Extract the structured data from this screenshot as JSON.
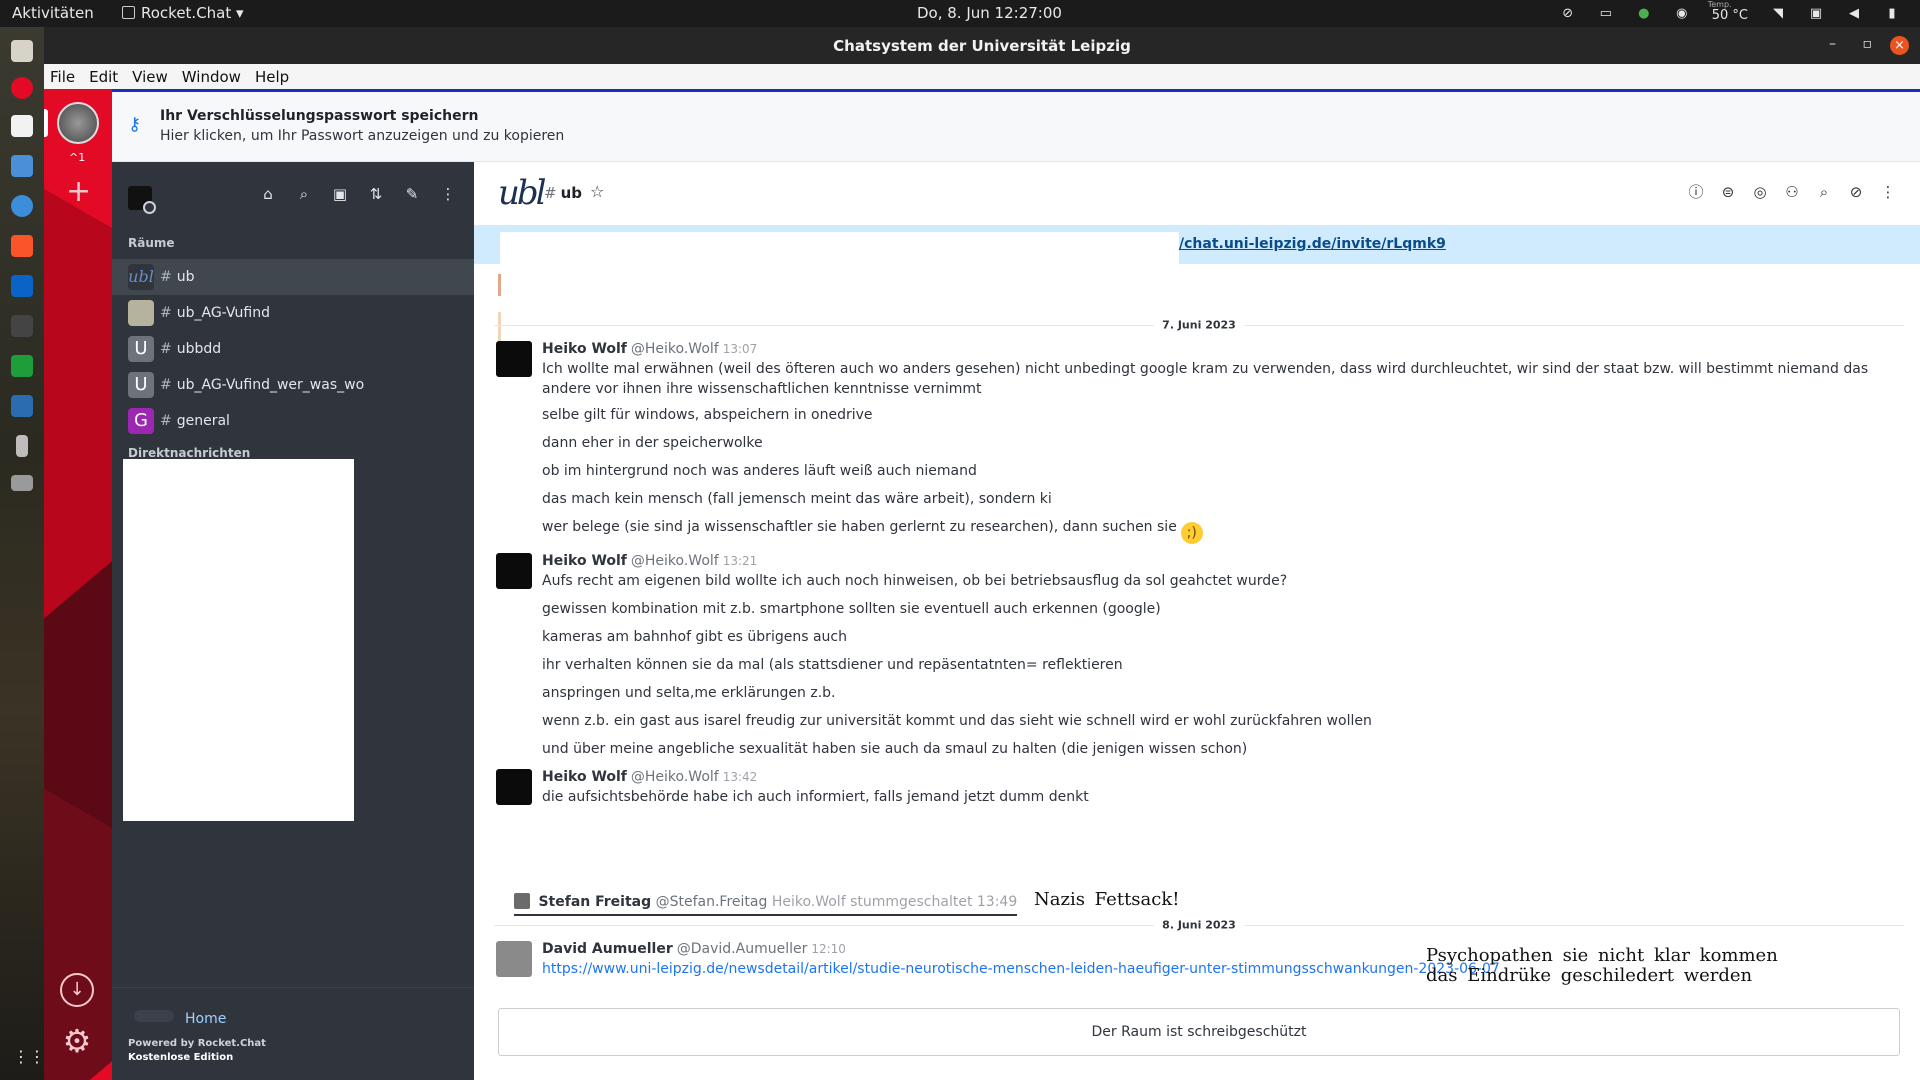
{
  "topbar": {
    "activities": "Aktivitäten",
    "app_name": "Rocket.Chat ▾",
    "clock": "Do,  8. Jun  12:27:00",
    "temp_label": "Temp.",
    "temp_value": "50 °C"
  },
  "window": {
    "title": "Chatsystem der Universität Leipzig"
  },
  "menu": [
    "File",
    "Edit",
    "View",
    "Window",
    "Help"
  ],
  "rail": {
    "shortcut": "^1"
  },
  "banner": {
    "title": "Ihr Verschlüsselungspasswort speichern",
    "subtitle": "Hier klicken, um Ihr Passwort anzuzeigen und zu kopieren"
  },
  "sidebar": {
    "rooms_label": "Räume",
    "dm_label": "Direktnachrichten",
    "rooms": [
      {
        "name": "ub",
        "avatar": "ubl",
        "color": "#2f343d"
      },
      {
        "name": "ub_AG-Vufind",
        "avatar": "",
        "color": "#8a8a7a"
      },
      {
        "name": "ubbdd",
        "avatar": "U",
        "color": "#6c737a"
      },
      {
        "name": "ub_AG-Vufind_wer_was_wo",
        "avatar": "U",
        "color": "#6c737a"
      },
      {
        "name": "general",
        "avatar": "G",
        "color": "#9c27b0"
      }
    ],
    "home": "Home",
    "powered": "Powered by Rocket.Chat",
    "edition": "Kostenlose Edition"
  },
  "room": {
    "logo": "ubl",
    "name": "ub",
    "invite_link": "/chat.uni-leipzig.de/invite/rLqmk9"
  },
  "days": {
    "day1": "7. Juni 2023",
    "day2": "8. Juni 2023"
  },
  "messages": [
    {
      "author": "Heiko Wolf",
      "username": "@Heiko.Wolf",
      "time": "13:07",
      "lines": [
        "Ich wollte mal erwähnen (weil des öfteren auch wo anders gesehen) nicht unbedingt google kram zu verwenden, dass wird durchleuchtet, wir sind der staat bzw. will bestimmt niemand das andere vor ihnen ihre wissenschaftlichen kenntnisse vernimmt",
        "selbe gilt für windows, abspeichern in onedrive",
        "dann eher in der speicherwolke",
        "ob im hintergrund noch was anderes läuft weiß auch niemand",
        "das mach kein mensch (fall jemensch meint das wäre arbeit), sondern ki",
        "wer belege (sie sind ja wissenschaftler sie haben gerlernt zu researchen), dann suchen sie"
      ]
    },
    {
      "author": "Heiko Wolf",
      "username": "@Heiko.Wolf",
      "time": "13:21",
      "lines": [
        "Aufs recht am eigenen bild wollte ich auch noch hinweisen, ob bei betriebsausflug da sol geahctet wurde?",
        "gewissen kombination mit z.b. smartphone sollten sie eventuell auch erkennen (google)",
        "kameras am bahnhof gibt es übrigens auch",
        "ihr verhalten können sie da mal (als stattsdiener und repäsentatnten= reflektieren",
        "anspringen und selta,me erklärungen z.b.",
        "wenn z.b. ein gast aus isarel freudig zur universität kommt und das sieht wie schnell wird er wohl zurückfahren wollen",
        "und über meine angebliche sexualität haben sie auch da smaul zu halten (die jenigen wissen schon)"
      ]
    },
    {
      "author": "Heiko Wolf",
      "username": "@Heiko.Wolf",
      "time": "13:42",
      "lines": [
        "die aufsichtsbehörde habe ich auch informiert, falls jemand jetzt dumm denkt"
      ]
    }
  ],
  "system_message": {
    "author": "Stefan Freitag",
    "username": "@Stefan.Freitag",
    "text": "Heiko.Wolf stummgeschaltet",
    "time": "13:49"
  },
  "last_message": {
    "author": "David Aumueller",
    "username": "@David.Aumueller",
    "time": "12:10",
    "link": "https://www.uni-leipzig.de/newsdetail/artikel/studie-neurotische-menschen-leiden-haeufiger-unter-stimmungsschwankungen-2023-06-07"
  },
  "overlays": {
    "text1": "Nazis  Fettsack!",
    "text2": "Psychopathen  sie  nicht  klar  kommen",
    "text3": "das  Eindrüke  geschiledert  werden"
  },
  "composer": {
    "readonly": "Der Raum ist schreibgeschützt"
  }
}
